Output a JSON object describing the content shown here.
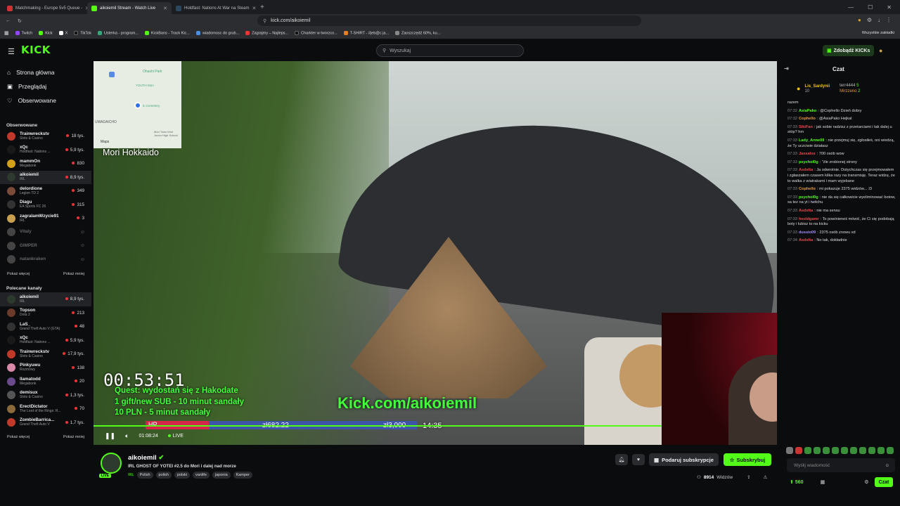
{
  "browser": {
    "tabs": [
      {
        "label": "Matchmaking - Europe 5v5 Queue -",
        "color": "#c33"
      },
      {
        "label": "aikoiemil Stream - Watch Live",
        "color": "#53fc18"
      },
      {
        "label": "Holdfast: Nations At War na Steam",
        "color": "#1b2838"
      }
    ],
    "url": "kick.com/aikoiemil",
    "bookmarks": [
      "Twitch",
      "Kick",
      "X",
      "TikTok",
      "Usterka - program...",
      "KickBans - Track Kic...",
      "wiadomosc do grub...",
      "Zagrajmy – Najleps...",
      "Charkter w tworzco...",
      "T-SHIRT - #jeb@c ja...",
      "Zaoszczędź 60%, ku..."
    ],
    "bookmarks_all": "Wszystkie zakładki"
  },
  "kick": {
    "logo": "KICK",
    "search_placeholder": "Wyszukaj",
    "get_kicks": "Zdobądź KICKs"
  },
  "sidebar": {
    "nav": [
      {
        "label": "Strona główna",
        "icon": "home-icon"
      },
      {
        "label": "Przeglądaj",
        "icon": "browse-icon"
      },
      {
        "label": "Obserwowane",
        "icon": "heart-icon"
      }
    ],
    "followed_title": "Obserwowane",
    "followed": [
      {
        "name": "Trainwreckstv",
        "cat": "Slots & Casino",
        "viewers": "18 tys.",
        "color": "#c0392b"
      },
      {
        "name": "xQc",
        "cat": "Holdfast: Nations ...",
        "viewers": "5,9 tys.",
        "color": "#1a1a1a"
      },
      {
        "name": "mammOn",
        "cat": "Megabonk",
        "viewers": "830",
        "color": "#d4a017"
      },
      {
        "name": "aikoiemil",
        "cat": "IRL",
        "viewers": "8,9 tys.",
        "color": "#2d3a2e"
      },
      {
        "name": "delordione",
        "cat": "Legion TD 2",
        "viewers": "349",
        "color": "#7a4a3a"
      },
      {
        "name": "Diagu",
        "cat": "EA Sports FC 26",
        "viewers": "315",
        "color": "#333"
      },
      {
        "name": "zagralamWzycie91",
        "cat": "IRL",
        "viewers": "3",
        "color": "#c8a050"
      },
      {
        "name": "Vitaly",
        "cat": "",
        "viewers": "",
        "color": "#444"
      },
      {
        "name": "GIMPER",
        "cat": "",
        "viewers": "",
        "color": "#444"
      },
      {
        "name": "natankraken",
        "cat": "",
        "viewers": "",
        "color": "#444"
      }
    ],
    "show_more": "Pokaż więcej",
    "show_less": "Pokaż mniej",
    "recommended_title": "Polecane kanały",
    "recommended": [
      {
        "name": "aikoiemil",
        "cat": "IRL",
        "viewers": "8,9 tys.",
        "color": "#2d3a2e"
      },
      {
        "name": "Topson",
        "cat": "Dota 2",
        "viewers": "213",
        "color": "#6a3a2a"
      },
      {
        "name": "LaS_",
        "cat": "Grand Theft Auto V (GTA)",
        "viewers": "48",
        "color": "#333"
      },
      {
        "name": "xQc",
        "cat": "Holdfast: Nations ...",
        "viewers": "5,9 tys.",
        "color": "#1a1a1a"
      },
      {
        "name": "Trainwreckstv",
        "cat": "Slots & Casino",
        "viewers": "17,9 tys.",
        "color": "#c0392b"
      },
      {
        "name": "Pinkyuwu",
        "cat": "Rozmowy",
        "viewers": "138",
        "color": "#d88aa8"
      },
      {
        "name": "llamatodd",
        "cat": "Megabonk",
        "viewers": "20",
        "color": "#6a4a8a"
      },
      {
        "name": "demisux",
        "cat": "Slots & Casino",
        "viewers": "1,3 tys.",
        "color": "#555"
      },
      {
        "name": "ErectDictator",
        "cat": "The Lord of the Rings: R...",
        "viewers": "70",
        "color": "#8a6a3a"
      },
      {
        "name": "ZombieBarrica...",
        "cat": "Grand Theft Auto V",
        "viewers": "1,7 tys.",
        "color": "#c0392b"
      }
    ]
  },
  "stream": {
    "map_label": "Mori Hokkaido",
    "map_places": [
      "Ohashi Park",
      "YOUTH Mori",
      "UWADAICHO",
      "in Cemetery",
      "Mori Town Mori Junior High School"
    ],
    "map_brand": "Maps",
    "timer": "00:53:51",
    "quest": [
      "Quest: wydostań się z Hakodate",
      "1 gift/new SUB - 10 minut sandały",
      "10 PLN - 5 minut sandały"
    ],
    "url_overlay": "Kick.com/aikoiemil",
    "hp_label": "HP",
    "hp_value": "zł682.22",
    "hp_goal": "zł3,000",
    "clock": "14:35",
    "elapsed": "01:08:24",
    "live": "LIVE",
    "progress": 1.0
  },
  "info": {
    "name": "aikoiemil",
    "live_badge": "LIVE",
    "title": "IRL GHOST OF YOTEI #2.5 do Mori i dalej nad morze",
    "category": "IRL",
    "tags": [
      "Polish",
      "polish",
      "polski",
      "vanlife",
      "japonia",
      "Kamper"
    ],
    "gift_label": "Podaruj subskrypcje",
    "sub_label": "Subskrybuj",
    "viewers": "8914",
    "viewers_label": "Widzów"
  },
  "chat": {
    "title": "Czat",
    "pinned": [
      {
        "user": "Lis_Sardynii",
        "count": "10",
        "color": "#f4c20d"
      },
      {
        "user": "terr4444",
        "count": "5",
        "color": "#bbb"
      },
      {
        "user": "Mirzzeno",
        "count": "2",
        "color": "#e69a3a"
      }
    ],
    "first_line": "razem",
    "messages": [
      {
        "t": "07:32",
        "u": "AsiaPako",
        "c": "#53fc18",
        "m": "@Cophello Dzień dobry"
      },
      {
        "t": "07:32",
        "u": "Cophello",
        "c": "#e69a3a",
        "m": "@AsiaPako Hejkal"
      },
      {
        "t": "07:33",
        "u": "SikiFan",
        "c": "#e64a4a",
        "m": "jak sobie radzisz z przetarciami i tak dalej u stóp? hm"
      },
      {
        "t": "07:33",
        "u": "Lady_Anne09",
        "c": "#53fc18",
        "m": "nie przejmuj się, zgłosiłeś, oni wiedzą, że Ty uczciwie działasz"
      },
      {
        "t": "07:33",
        "u": "Jaxsalos",
        "c": "#e64a4a",
        "m": "700 osób wow"
      },
      {
        "t": "07:33",
        "u": "psychol0g",
        "c": "#53fc18",
        "m": "\"źle zrobionej strony"
      },
      {
        "t": "07:33",
        "u": "Asdelta",
        "c": "#e64a4a",
        "m": "Ja odwrotnie. Dotychczas się przejmowałem i zgłaszałem czasem kilka razy na transmisję. Teraz widzę, że to walka z wiatrakami i mam wyjebane"
      },
      {
        "t": "07:33",
        "u": "Cophello",
        "c": "#e69a3a",
        "m": "mi pokazuje 2375 widzów... :D"
      },
      {
        "t": "07:33",
        "u": "psychol0g",
        "c": "#53fc18",
        "m": "nie da się całkowicie wyeliminować botow, sa tez na yt i twitchu"
      },
      {
        "t": "07:33",
        "u": "Asdelta",
        "c": "#e64a4a",
        "m": "nie ma sensu"
      },
      {
        "t": "07:33",
        "u": "heoldgamr",
        "c": "#e64a4a",
        "m": "To powinieneś mówić, że Ci się podobają boty i lubisz to na kicku"
      },
      {
        "t": "07:33",
        "u": "dussio09",
        "c": "#a78bfa",
        "m": "2375 osób znowu xd"
      },
      {
        "t": "07:34",
        "u": "Asdelta",
        "c": "#e64a4a",
        "m": "No tak, dokładnie"
      }
    ],
    "input_placeholder": "Wyślij wiadomość",
    "points": "560",
    "send_label": "Czat"
  }
}
